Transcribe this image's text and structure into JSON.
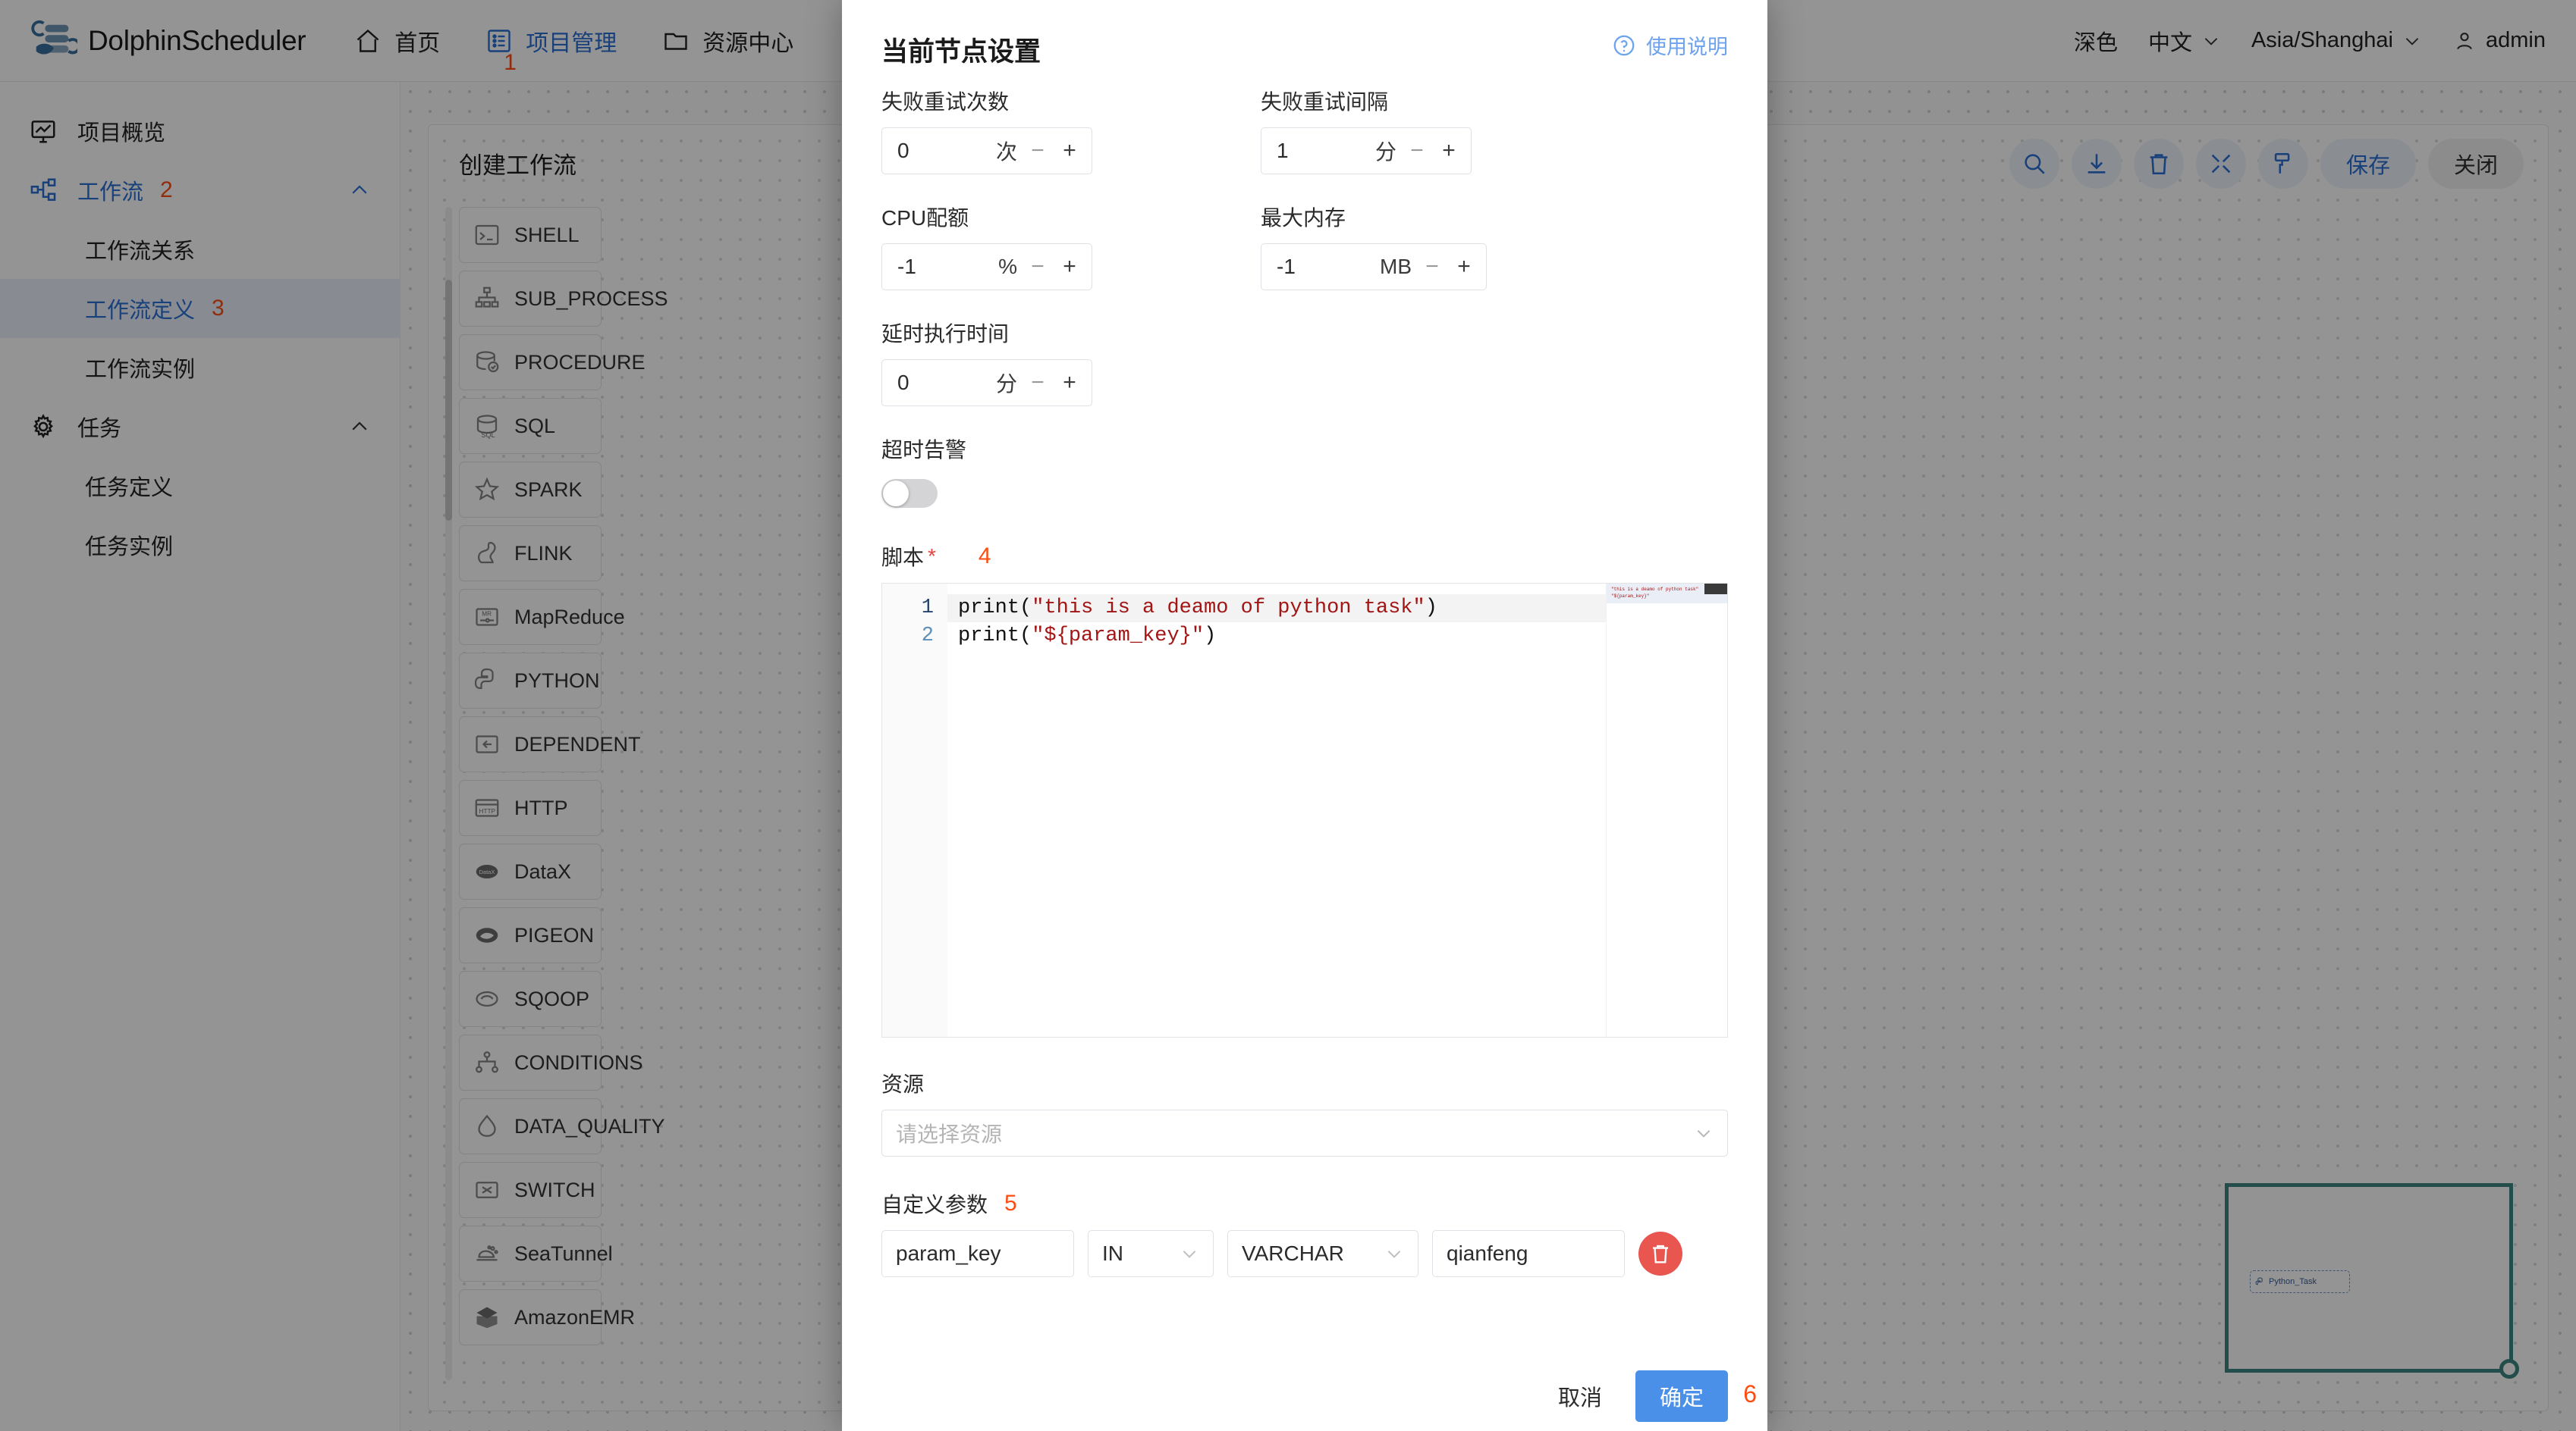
{
  "header": {
    "brand": "DolphinScheduler",
    "nav": [
      {
        "label": "首页",
        "icon": "home-icon",
        "active": false
      },
      {
        "label": "项目管理",
        "icon": "project-icon",
        "active": true,
        "annotation": "1"
      },
      {
        "label": "资源中心",
        "icon": "folder-icon",
        "active": false
      }
    ],
    "theme_label": "深色",
    "language": "中文",
    "timezone": "Asia/Shanghai",
    "user": "admin"
  },
  "sidebar": {
    "items": [
      {
        "label": "项目概览",
        "icon": "overview-icon",
        "level": "top",
        "state": "normal"
      },
      {
        "label": "工作流",
        "icon": "workflow-icon",
        "level": "top",
        "state": "blue",
        "annotation": "2",
        "caret": "chevron-up-icon"
      },
      {
        "label": "工作流关系",
        "level": "sub",
        "state": "normal"
      },
      {
        "label": "工作流定义",
        "level": "sub",
        "state": "selected",
        "annotation": "3"
      },
      {
        "label": "工作流实例",
        "level": "sub",
        "state": "normal"
      },
      {
        "label": "任务",
        "icon": "gear-icon",
        "level": "top",
        "state": "normal",
        "caret": "chevron-up-icon"
      },
      {
        "label": "任务定义",
        "level": "sub",
        "state": "normal"
      },
      {
        "label": "任务实例",
        "level": "sub",
        "state": "normal"
      }
    ]
  },
  "canvas": {
    "title": "创建工作流",
    "tools": [
      {
        "name": "search-icon",
        "label": "搜索"
      },
      {
        "name": "download-icon",
        "label": "下载"
      },
      {
        "name": "trash-icon",
        "label": "删除"
      },
      {
        "name": "fullscreen-icon",
        "label": "全屏"
      },
      {
        "name": "format-icon",
        "label": "格式化"
      }
    ],
    "save_label": "保存",
    "close_label": "关闭",
    "task_types": [
      {
        "label": "SHELL",
        "icon": "terminal-icon"
      },
      {
        "label": "SUB_PROCESS",
        "icon": "subprocess-icon"
      },
      {
        "label": "PROCEDURE",
        "icon": "database-check-icon"
      },
      {
        "label": "SQL",
        "icon": "database-sql-icon"
      },
      {
        "label": "SPARK",
        "icon": "star-icon"
      },
      {
        "label": "FLINK",
        "icon": "squirrel-icon"
      },
      {
        "label": "MapReduce",
        "icon": "mapreduce-icon"
      },
      {
        "label": "PYTHON",
        "icon": "python-icon"
      },
      {
        "label": "DEPENDENT",
        "icon": "dependent-icon"
      },
      {
        "label": "HTTP",
        "icon": "http-icon"
      },
      {
        "label": "DataX",
        "icon": "datax-icon"
      },
      {
        "label": "PIGEON",
        "icon": "pigeon-icon"
      },
      {
        "label": "SQOOP",
        "icon": "sqoop-icon"
      },
      {
        "label": "CONDITIONS",
        "icon": "conditions-icon"
      },
      {
        "label": "DATA_QUALITY",
        "icon": "drop-icon"
      },
      {
        "label": "SWITCH",
        "icon": "switch-icon"
      },
      {
        "label": "SeaTunnel",
        "icon": "seatunnel-icon"
      },
      {
        "label": "AmazonEMR",
        "icon": "emr-icon"
      }
    ],
    "minimap_node": "Python_Task"
  },
  "modal": {
    "title": "当前节点设置",
    "help_label": "使用说明",
    "fields": {
      "retry_times": {
        "label": "失败重试次数",
        "value": "0",
        "unit": "次"
      },
      "retry_interval": {
        "label": "失败重试间隔",
        "value": "1",
        "unit": "分"
      },
      "cpu_quota": {
        "label": "CPU配额",
        "value": "-1",
        "unit": "%"
      },
      "max_memory": {
        "label": "最大内存",
        "value": "-1",
        "unit": "MB"
      },
      "delay_time": {
        "label": "延时执行时间",
        "value": "0",
        "unit": "分"
      },
      "timeout_alarm": {
        "label": "超时告警",
        "value": "off"
      },
      "script": {
        "label": "脚本",
        "required": "*",
        "annotation": "4",
        "lines": [
          {
            "no": "1",
            "prefix": "print(",
            "string": "\"this is a deamo of python task\"",
            "suffix": ")"
          },
          {
            "no": "2",
            "prefix": "print(",
            "string": "\"${param_key}\"",
            "suffix": ")"
          }
        ]
      },
      "resource": {
        "label": "资源",
        "placeholder": "请选择资源"
      },
      "custom_params": {
        "label": "自定义参数",
        "annotation": "5",
        "rows": [
          {
            "key": "param_key",
            "direction": "IN",
            "type": "VARCHAR",
            "value": "qianfeng"
          }
        ]
      }
    },
    "footer": {
      "cancel": "取消",
      "confirm": "确定",
      "annotation": "6"
    }
  },
  "colors": {
    "accent": "#2a6fd4",
    "primary_button": "#4a90e8",
    "danger": "#e8564f",
    "annotation": "#ff4d11",
    "minimap_border": "#3b8681"
  }
}
